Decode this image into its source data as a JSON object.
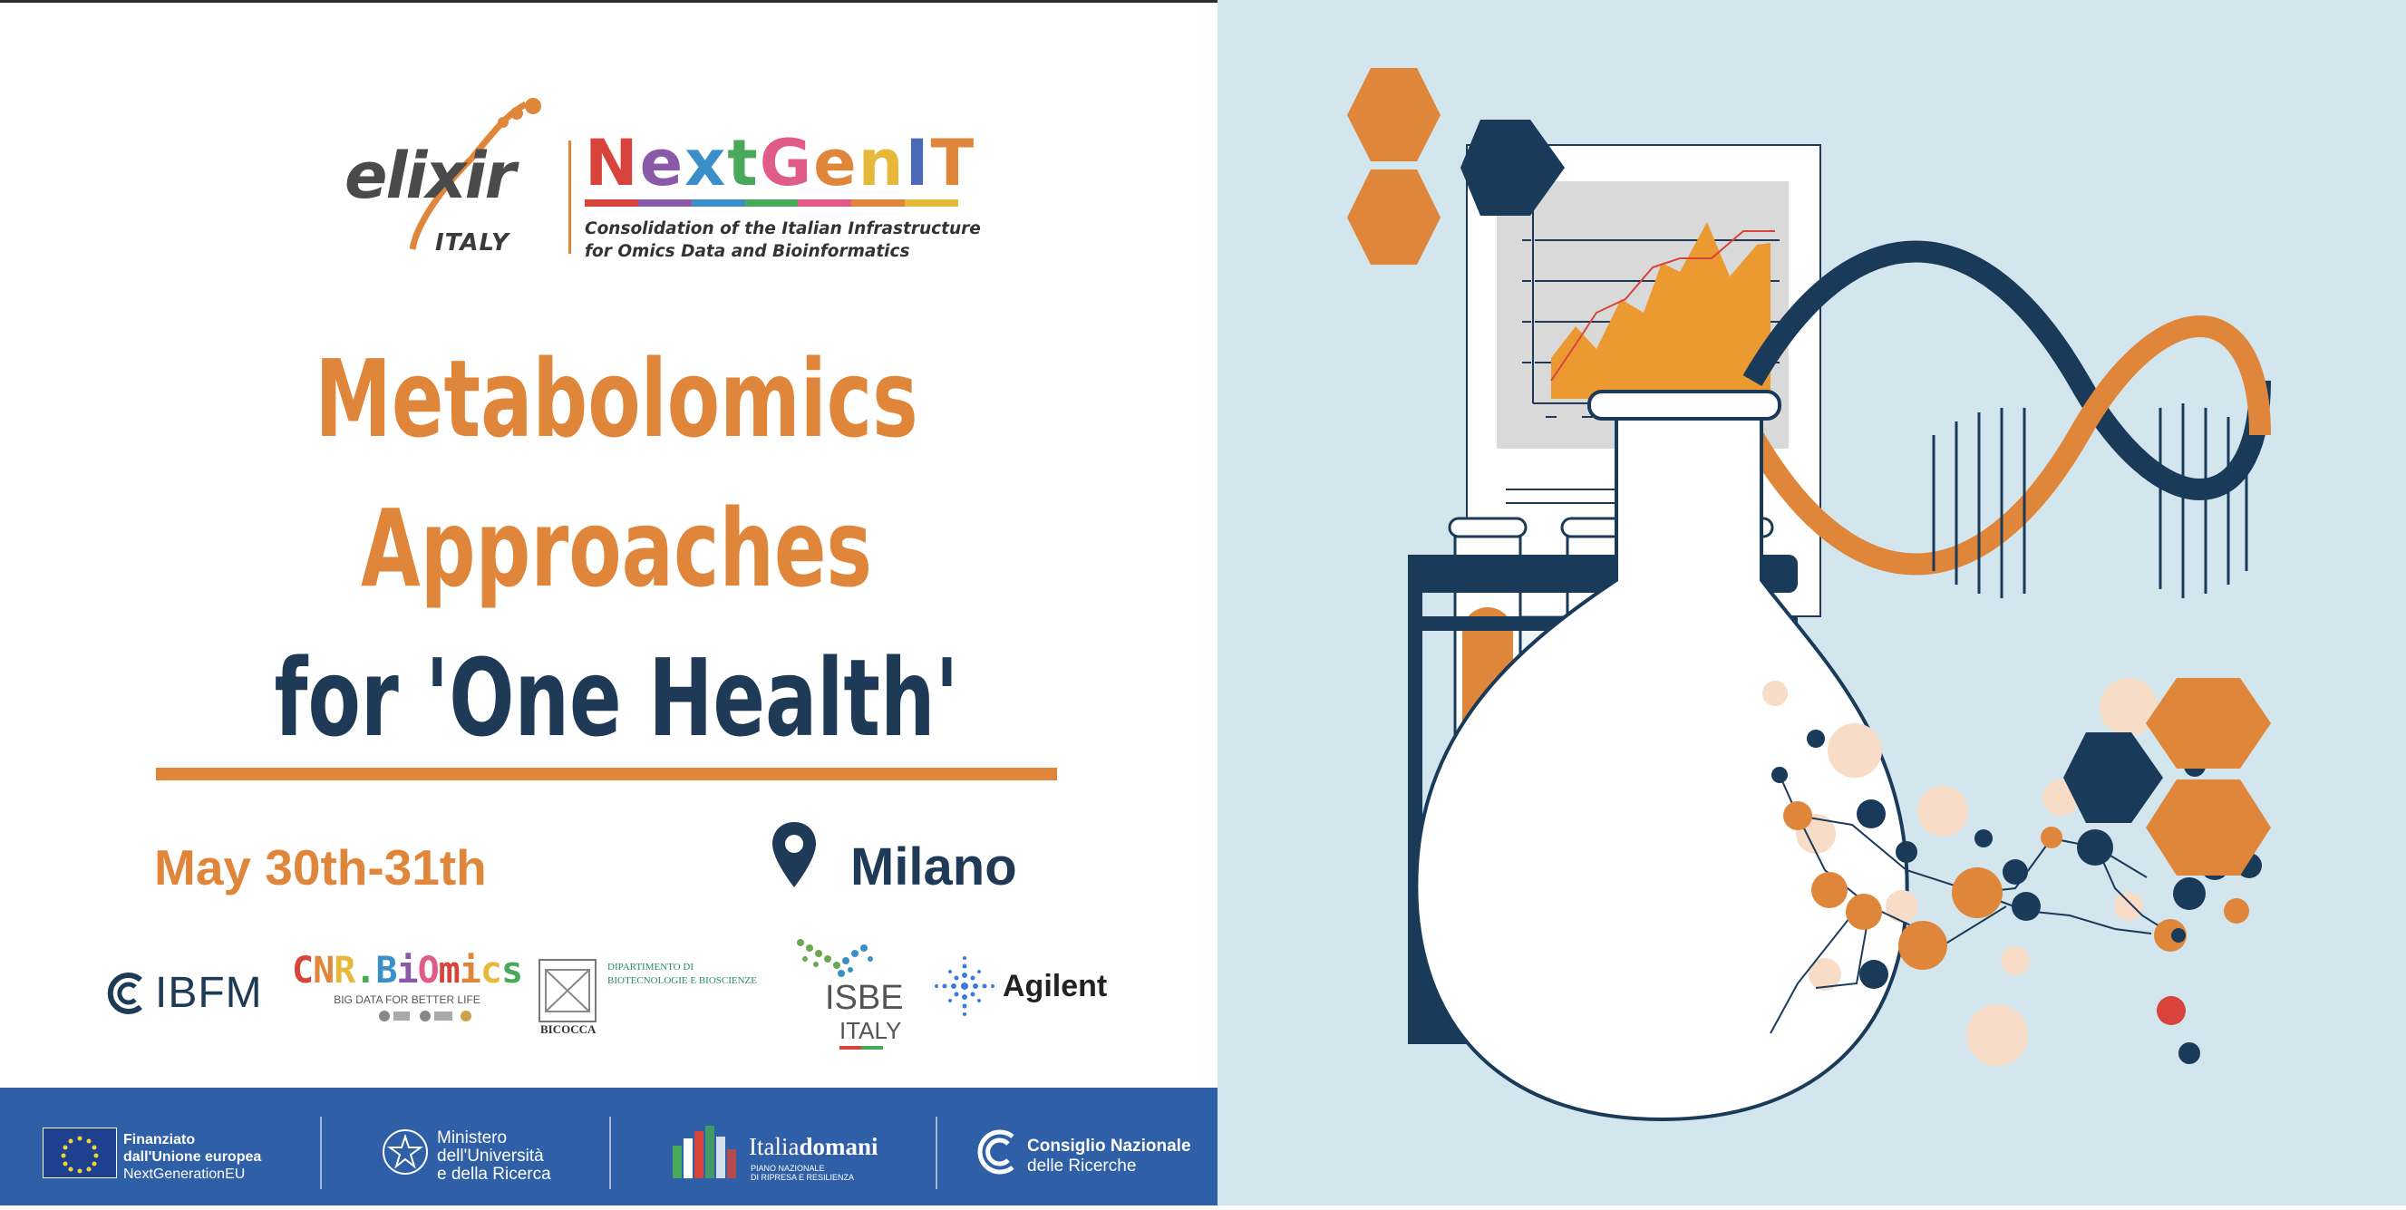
{
  "header": {
    "elixir": {
      "word": "elixir",
      "country": "ITALY"
    },
    "nextgenit": {
      "letters": [
        {
          "ch": "N",
          "color": "#d8433b"
        },
        {
          "ch": "e",
          "color": "#8a5aa8"
        },
        {
          "ch": "x",
          "color": "#3b8fc9"
        },
        {
          "ch": "t",
          "color": "#4aa85a"
        },
        {
          "ch": "G",
          "color": "#e05a8a"
        },
        {
          "ch": "e",
          "color": "#e0863a"
        },
        {
          "ch": "n",
          "color": "#e6b93a"
        },
        {
          "ch": "I",
          "color": "#4a6ab8"
        },
        {
          "ch": "T",
          "color": "#e0863a"
        }
      ],
      "subtitle_line1": "Consolidation of the Italian Infrastructure",
      "subtitle_line2": "for Omics Data and Bioinformatics"
    }
  },
  "title": {
    "line1": "Metabolomics",
    "line2": "Approaches",
    "line3": "for 'One Health'"
  },
  "event": {
    "date": "May 30th-31th",
    "location": "Milano"
  },
  "partners": {
    "ibfm": "IBFM",
    "cnr_biomics": "CNR.BiOmics",
    "cnr_biomics_tagline": "BIG DATA FOR BETTER LIFE",
    "bicocca": "BICOCCA",
    "bicocca_dept_line1": "DIPARTIMENTO DI",
    "bicocca_dept_line2": "BIOTECNOLOGIE E BIOSCIENZE",
    "isbe": "ISBE",
    "isbe_country": "ITALY",
    "agilent": "Agilent"
  },
  "footer": {
    "eu_line1": "Finanziato",
    "eu_line2": "dall'Unione europea",
    "eu_line3": "NextGenerationEU",
    "mur_line1": "Ministero",
    "mur_line2": "dell'Università",
    "mur_line3": "e della Ricerca",
    "italia_a": "Italia",
    "italia_b": "domani",
    "italia_sub1": "PIANO NAZIONALE",
    "italia_sub2": "DI RIPRESA E RESILIENZA",
    "cnr_line1": "Consiglio Nazionale",
    "cnr_line2": "delle Ricerche"
  },
  "colors": {
    "orange": "#e0863a",
    "navy": "#1f3a57",
    "footer_blue": "#2f5fa7",
    "illustration_bg": "#d3e6ee"
  },
  "illustration": {
    "icons": [
      "hexagon-icon",
      "report-chart-icon",
      "test-tube-rack-icon",
      "flask-icon",
      "dna-helix-icon",
      "molecule-icon"
    ]
  }
}
